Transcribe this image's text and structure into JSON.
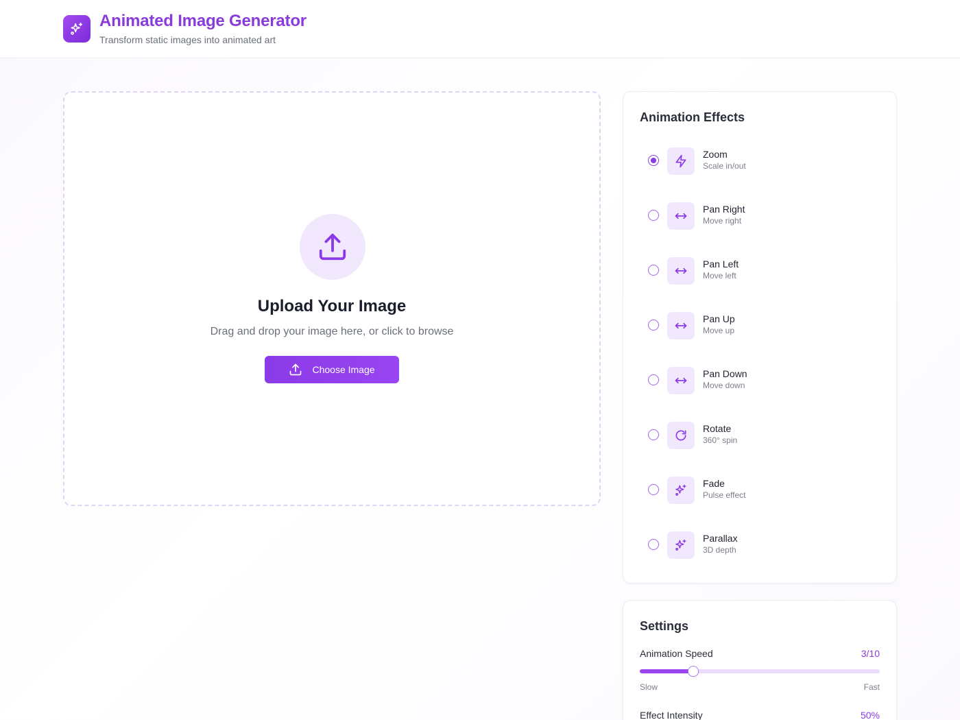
{
  "header": {
    "title": "Animated Image Generator",
    "subtitle": "Transform static images into animated art",
    "logo_icon": "sparkles-icon"
  },
  "upload": {
    "icon": "upload-icon",
    "title": "Upload Your Image",
    "description": "Drag and drop your image here, or click to browse",
    "button_label": "Choose Image"
  },
  "effects": {
    "title": "Animation Effects",
    "selected": "Zoom",
    "items": [
      {
        "name": "Zoom",
        "desc": "Scale in/out",
        "icon": "zap-icon",
        "checked": true
      },
      {
        "name": "Pan Right",
        "desc": "Move right",
        "icon": "arrows-horizontal-icon",
        "checked": false
      },
      {
        "name": "Pan Left",
        "desc": "Move left",
        "icon": "arrows-horizontal-icon",
        "checked": false
      },
      {
        "name": "Pan Up",
        "desc": "Move up",
        "icon": "arrows-horizontal-icon",
        "checked": false
      },
      {
        "name": "Pan Down",
        "desc": "Move down",
        "icon": "arrows-horizontal-icon",
        "checked": false
      },
      {
        "name": "Rotate",
        "desc": "360° spin",
        "icon": "rotate-icon",
        "checked": false
      },
      {
        "name": "Fade",
        "desc": "Pulse effect",
        "icon": "sparkles-icon",
        "checked": false
      },
      {
        "name": "Parallax",
        "desc": "3D depth",
        "icon": "sparkles-icon",
        "checked": false
      }
    ]
  },
  "settings": {
    "title": "Settings",
    "speed": {
      "label": "Animation Speed",
      "value_text": "3/10",
      "value": 3,
      "max": 10,
      "min_label": "Slow",
      "max_label": "Fast"
    },
    "intensity": {
      "label": "Effect Intensity",
      "value_text": "50%"
    }
  },
  "colors": {
    "accent": "#8a3ae6",
    "accent_light": "#f1e8fd",
    "text": "#1f2230",
    "muted": "#6b6f7b"
  }
}
